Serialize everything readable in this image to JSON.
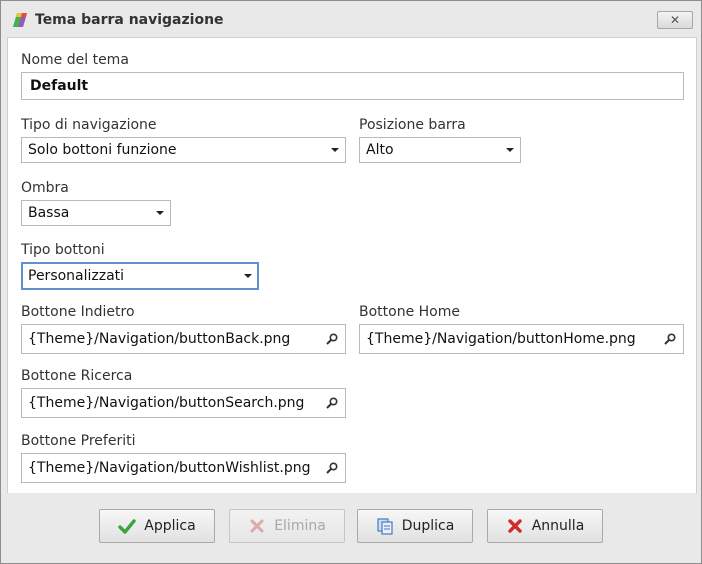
{
  "window": {
    "title": "Tema barra navigazione"
  },
  "form": {
    "theme_name": {
      "label": "Nome del tema",
      "value": "Default"
    },
    "nav_type": {
      "label": "Tipo di navigazione",
      "value": "Solo bottoni funzione"
    },
    "bar_position": {
      "label": "Posizione barra",
      "value": "Alto"
    },
    "shadow": {
      "label": "Ombra",
      "value": "Bassa"
    },
    "button_type": {
      "label": "Tipo bottoni",
      "value": "Personalizzati"
    },
    "button_back": {
      "label": "Bottone Indietro",
      "value": "{Theme}/Navigation/buttonBack.png"
    },
    "button_home": {
      "label": "Bottone Home",
      "value": "{Theme}/Navigation/buttonHome.png"
    },
    "button_search": {
      "label": "Bottone Ricerca",
      "value": "{Theme}/Navigation/buttonSearch.png"
    },
    "button_wishlist": {
      "label": "Bottone Preferiti",
      "value": "{Theme}/Navigation/buttonWishlist.png"
    }
  },
  "footer": {
    "apply_label": "Applica",
    "delete_label": "Elimina",
    "duplicate_label": "Duplica",
    "cancel_label": "Annulla"
  },
  "icons": {
    "app": "palette-icon",
    "close": "close-icon",
    "browse": "search-icon",
    "apply": "checkmark-icon",
    "delete": "x-icon",
    "duplicate": "copy-icon",
    "cancel": "x-icon"
  },
  "colors": {
    "apply_check": "#3aa53a",
    "cancel_x": "#d12a2a",
    "focus_border": "#5f8fd0"
  }
}
